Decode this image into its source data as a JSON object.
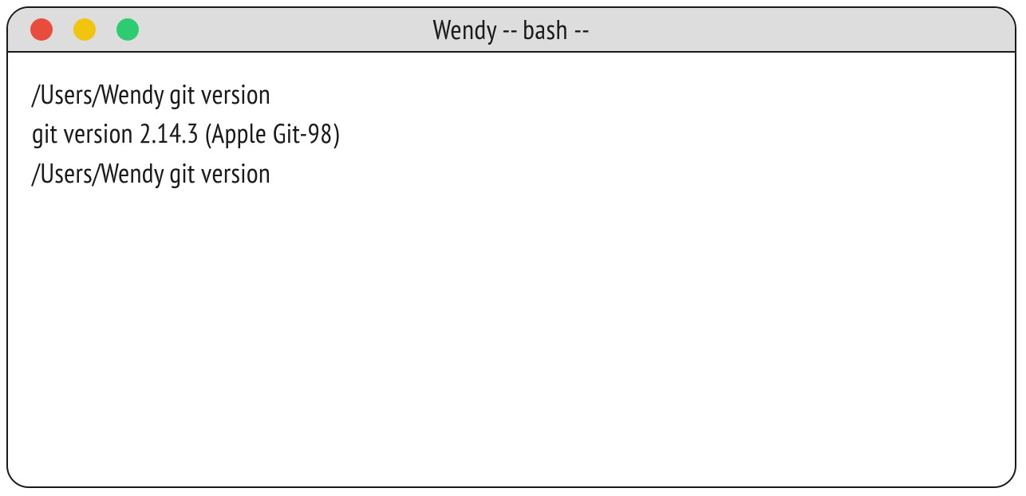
{
  "window": {
    "title": "Wendy -- bash --"
  },
  "terminal": {
    "lines": [
      "/Users/Wendy git version",
      "git version 2.14.3 (Apple Git-98)",
      "/Users/Wendy git version"
    ]
  }
}
